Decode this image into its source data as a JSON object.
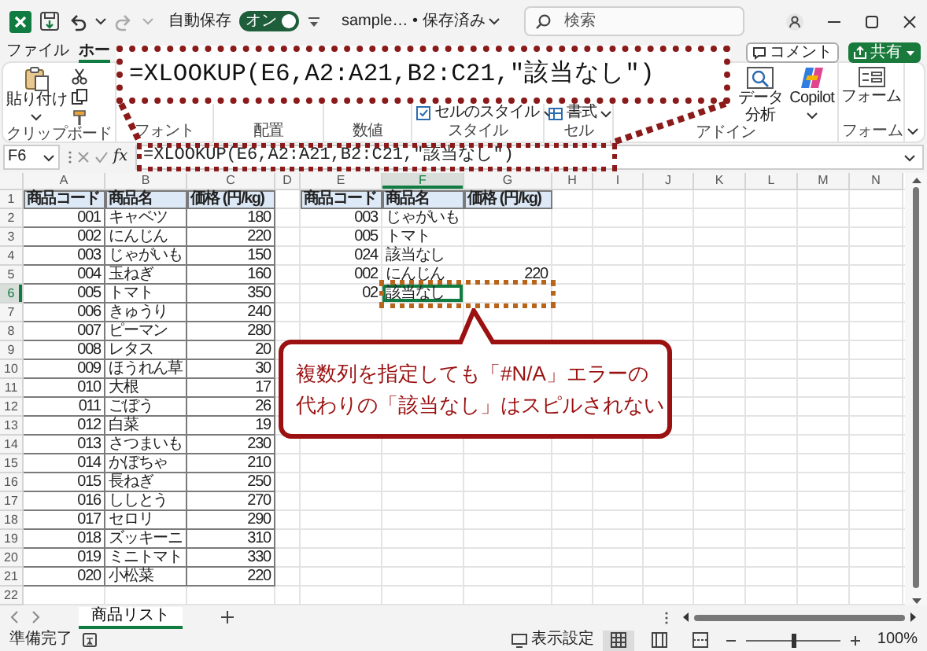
{
  "title_bar": {
    "autosave": {
      "label": "自動保存",
      "toggle_label": "オン",
      "on": true
    },
    "file_name": "sample… • 保存済み",
    "search": {
      "placeholder": "検索"
    }
  },
  "ribbon": {
    "tabs": [
      {
        "label": "ファイル",
        "selected": false
      },
      {
        "label": "ホー",
        "selected": true
      }
    ],
    "comment_button": "コメント",
    "share_button": "共有",
    "groups": [
      {
        "label": "クリップボード",
        "buttons": [
          {
            "label": "貼り付け",
            "kind": "paste"
          },
          {
            "kind": "cut"
          },
          {
            "kind": "copy"
          },
          {
            "kind": "painter"
          }
        ]
      },
      {
        "label": "フォント"
      },
      {
        "label": "配置"
      },
      {
        "label": "数値"
      },
      {
        "label": "スタイル",
        "buttons": [
          {
            "label": "セルのスタイル",
            "kind": "cell-style"
          }
        ]
      },
      {
        "label": "セル",
        "buttons": [
          {
            "label": "書式",
            "kind": "format"
          }
        ]
      },
      {
        "label": "アドイン",
        "buttons": [
          {
            "label": "データ分析",
            "kind": "analyze"
          },
          {
            "label": "Copilot",
            "kind": "copilot"
          }
        ]
      },
      {
        "label": "フォーム",
        "buttons": [
          {
            "label": "フォーム",
            "kind": "form"
          }
        ]
      }
    ]
  },
  "formula_bar": {
    "name_box": "F6",
    "function_button": "fx",
    "formula": "=XLOOKUP(E6,A2:A21,B2:C21,\"該当なし\")"
  },
  "sheet": {
    "columns": [
      {
        "label": "A",
        "selected": false
      },
      {
        "label": "B",
        "selected": false
      },
      {
        "label": "C",
        "selected": false
      },
      {
        "label": "D",
        "selected": false
      },
      {
        "label": "E",
        "selected": false
      },
      {
        "label": "F",
        "selected": true
      },
      {
        "label": "G",
        "selected": false
      },
      {
        "label": "H",
        "selected": false
      },
      {
        "label": "I",
        "selected": false
      },
      {
        "label": "J",
        "selected": false
      },
      {
        "label": "K",
        "selected": false
      },
      {
        "label": "L",
        "selected": false
      },
      {
        "label": "M",
        "selected": false
      },
      {
        "label": "N",
        "selected": false
      }
    ],
    "rows": [
      {
        "number": "1",
        "selected": false,
        "cells": [
          {
            "text": "商品コード",
            "kind": "header"
          },
          {
            "text": "商品名",
            "kind": "header"
          },
          {
            "text": "価格 (円/kg)",
            "kind": "header"
          },
          {
            "kind": "empty"
          },
          {
            "text": "商品コード",
            "kind": "header"
          },
          {
            "text": "商品名",
            "kind": "header"
          },
          {
            "text": "価格 (円/kg)",
            "kind": "header"
          }
        ]
      },
      {
        "number": "2",
        "selected": false,
        "cells": [
          {
            "text": "001",
            "kind": "number",
            "boxed": true
          },
          {
            "text": "キャベツ",
            "kind": "text",
            "boxed": true
          },
          {
            "text": "180",
            "kind": "number",
            "boxed": true
          },
          {
            "kind": "empty"
          },
          {
            "text": "003",
            "kind": "number",
            "boxed": false
          },
          {
            "text": "じゃがいも",
            "kind": "text",
            "boxed": false
          }
        ]
      },
      {
        "number": "3",
        "selected": false,
        "cells": [
          {
            "text": "002",
            "kind": "number",
            "boxed": true
          },
          {
            "text": "にんじん",
            "kind": "text",
            "boxed": true
          },
          {
            "text": "220",
            "kind": "number",
            "boxed": true
          },
          {
            "kind": "empty"
          },
          {
            "text": "005",
            "kind": "number",
            "boxed": false
          },
          {
            "text": "トマト",
            "kind": "text",
            "boxed": false
          }
        ]
      },
      {
        "number": "4",
        "selected": false,
        "cells": [
          {
            "text": "003",
            "kind": "number",
            "boxed": true
          },
          {
            "text": "じゃがいも",
            "kind": "text",
            "boxed": true
          },
          {
            "text": "150",
            "kind": "number",
            "boxed": true
          },
          {
            "kind": "empty"
          },
          {
            "text": "024",
            "kind": "number",
            "boxed": false
          },
          {
            "text": "該当なし",
            "kind": "text",
            "boxed": false
          }
        ]
      },
      {
        "number": "5",
        "selected": false,
        "cells": [
          {
            "text": "004",
            "kind": "number",
            "boxed": true
          },
          {
            "text": "玉ねぎ",
            "kind": "text",
            "boxed": true
          },
          {
            "text": "160",
            "kind": "number",
            "boxed": true
          },
          {
            "kind": "empty"
          },
          {
            "text": "002",
            "kind": "number",
            "boxed": false
          },
          {
            "text": "にんじん",
            "kind": "text",
            "boxed": false
          },
          {
            "text": "220",
            "kind": "number",
            "boxed": false
          }
        ]
      },
      {
        "number": "6",
        "selected": true,
        "cells": [
          {
            "text": "005",
            "kind": "number",
            "boxed": true
          },
          {
            "text": "トマト",
            "kind": "text",
            "boxed": true
          },
          {
            "text": "350",
            "kind": "number",
            "boxed": true
          },
          {
            "kind": "empty"
          },
          {
            "text": "02",
            "kind": "number",
            "boxed": false
          },
          {
            "text": "該当なし",
            "kind": "text",
            "boxed": false
          }
        ]
      },
      {
        "number": "7",
        "selected": false,
        "cells": [
          {
            "text": "006",
            "kind": "number",
            "boxed": true
          },
          {
            "text": "きゅうり",
            "kind": "text",
            "boxed": true
          },
          {
            "text": "240",
            "kind": "number",
            "boxed": true
          }
        ]
      },
      {
        "number": "8",
        "selected": false,
        "cells": [
          {
            "text": "007",
            "kind": "number",
            "boxed": true
          },
          {
            "text": "ピーマン",
            "kind": "text",
            "boxed": true
          },
          {
            "text": "280",
            "kind": "number",
            "boxed": true
          }
        ]
      },
      {
        "number": "9",
        "selected": false,
        "cells": [
          {
            "text": "008",
            "kind": "number",
            "boxed": true
          },
          {
            "text": "レタス",
            "kind": "text",
            "boxed": true
          },
          {
            "text": "20",
            "kind": "number",
            "boxed": true
          }
        ]
      },
      {
        "number": "10",
        "selected": false,
        "cells": [
          {
            "text": "009",
            "kind": "number",
            "boxed": true
          },
          {
            "text": "ほうれん草",
            "kind": "text",
            "boxed": true
          },
          {
            "text": "30",
            "kind": "number",
            "boxed": true
          }
        ]
      },
      {
        "number": "11",
        "selected": false,
        "cells": [
          {
            "text": "010",
            "kind": "number",
            "boxed": true
          },
          {
            "text": "大根",
            "kind": "text",
            "boxed": true
          },
          {
            "text": "17",
            "kind": "number",
            "boxed": true
          }
        ]
      },
      {
        "number": "12",
        "selected": false,
        "cells": [
          {
            "text": "011",
            "kind": "number",
            "boxed": true
          },
          {
            "text": "ごぼう",
            "kind": "text",
            "boxed": true
          },
          {
            "text": "26",
            "kind": "number",
            "boxed": true
          }
        ]
      },
      {
        "number": "13",
        "selected": false,
        "cells": [
          {
            "text": "012",
            "kind": "number",
            "boxed": true
          },
          {
            "text": "白菜",
            "kind": "text",
            "boxed": true
          },
          {
            "text": "19",
            "kind": "number",
            "boxed": true
          }
        ]
      },
      {
        "number": "14",
        "selected": false,
        "cells": [
          {
            "text": "013",
            "kind": "number",
            "boxed": true
          },
          {
            "text": "さつまいも",
            "kind": "text",
            "boxed": true
          },
          {
            "text": "230",
            "kind": "number",
            "boxed": true
          }
        ]
      },
      {
        "number": "15",
        "selected": false,
        "cells": [
          {
            "text": "014",
            "kind": "number",
            "boxed": true
          },
          {
            "text": "かぼちゃ",
            "kind": "text",
            "boxed": true
          },
          {
            "text": "210",
            "kind": "number",
            "boxed": true
          }
        ]
      },
      {
        "number": "16",
        "selected": false,
        "cells": [
          {
            "text": "015",
            "kind": "number",
            "boxed": true
          },
          {
            "text": "長ねぎ",
            "kind": "text",
            "boxed": true
          },
          {
            "text": "250",
            "kind": "number",
            "boxed": true
          }
        ]
      },
      {
        "number": "17",
        "selected": false,
        "cells": [
          {
            "text": "016",
            "kind": "number",
            "boxed": true
          },
          {
            "text": "ししとう",
            "kind": "text",
            "boxed": true
          },
          {
            "text": "270",
            "kind": "number",
            "boxed": true
          }
        ]
      },
      {
        "number": "18",
        "selected": false,
        "cells": [
          {
            "text": "017",
            "kind": "number",
            "boxed": true
          },
          {
            "text": "セロリ",
            "kind": "text",
            "boxed": true
          },
          {
            "text": "290",
            "kind": "number",
            "boxed": true
          }
        ]
      },
      {
        "number": "19",
        "selected": false,
        "cells": [
          {
            "text": "018",
            "kind": "number",
            "boxed": true
          },
          {
            "text": "ズッキーニ",
            "kind": "text",
            "boxed": true
          },
          {
            "text": "310",
            "kind": "number",
            "boxed": true
          }
        ]
      },
      {
        "number": "20",
        "selected": false,
        "cells": [
          {
            "text": "019",
            "kind": "number",
            "boxed": true
          },
          {
            "text": "ミニトマト",
            "kind": "text",
            "boxed": true
          },
          {
            "text": "330",
            "kind": "number",
            "boxed": true
          }
        ]
      },
      {
        "number": "21",
        "selected": false,
        "cells": [
          {
            "text": "020",
            "kind": "number",
            "boxed": true
          },
          {
            "text": "小松菜",
            "kind": "text",
            "boxed": true
          },
          {
            "text": "220",
            "kind": "number",
            "boxed": true
          }
        ]
      },
      {
        "number": "22",
        "selected": false
      }
    ]
  },
  "sheet_tabs": [
    {
      "label": "商品リスト",
      "selected": true
    }
  ],
  "status_bar": {
    "status": "準備完了",
    "display_settings": "表示設定",
    "views": [
      {
        "kind": "normal",
        "selected": true
      },
      {
        "kind": "page-layout",
        "selected": false
      },
      {
        "kind": "page-break",
        "selected": false
      }
    ],
    "zoom": {
      "level": 0.5,
      "reading": "100%"
    }
  },
  "annotations": {
    "formula_callout": "=XLOOKUP(E6,A2:A21,B2:C21,\"該当なし\")",
    "note": [
      "複数列を指定しても「#N/A」エラーの",
      "代わりの「該当なし」はスピルされない"
    ]
  }
}
